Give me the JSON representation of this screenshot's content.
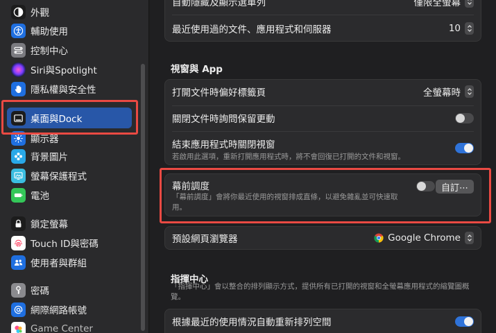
{
  "sidebar": {
    "items": [
      {
        "label": "外觀",
        "icon": "appearance-icon"
      },
      {
        "label": "輔助使用",
        "icon": "accessibility-icon"
      },
      {
        "label": "控制中心",
        "icon": "control-center-icon"
      },
      {
        "label": "Siri與Spotlight",
        "icon": "siri-icon"
      },
      {
        "label": "隱私權與安全性",
        "icon": "hand-icon"
      },
      {
        "label": "桌面與Dock",
        "icon": "dock-icon"
      },
      {
        "label": "顯示器",
        "icon": "display-icon"
      },
      {
        "label": "背景圖片",
        "icon": "wallpaper-icon"
      },
      {
        "label": "螢幕保護程式",
        "icon": "screensaver-icon"
      },
      {
        "label": "電池",
        "icon": "battery-icon"
      },
      {
        "label": "鎖定螢幕",
        "icon": "lock-icon"
      },
      {
        "label": "Touch ID與密碼",
        "icon": "fingerprint-icon"
      },
      {
        "label": "使用者與群組",
        "icon": "users-icon"
      },
      {
        "label": "密碼",
        "icon": "key-icon"
      },
      {
        "label": "網際網路帳號",
        "icon": "at-icon"
      },
      {
        "label": "Game Center",
        "icon": "game-center-icon"
      }
    ]
  },
  "main": {
    "top_card": {
      "row1_label": "自動隱藏及顯示選單列",
      "row1_value": "僅限全螢幕",
      "row2_label": "最近使用過的文件、應用程式和伺服器",
      "row2_value": "10"
    },
    "windows_section": {
      "title": "視窗與 App",
      "tabs_label": "打開文件時偏好標籤頁",
      "tabs_value": "全螢幕時",
      "ask_save_label": "關閉文件時詢問保留更動",
      "close_windows_label": "結束應用程式時關閉視窗",
      "close_windows_desc": "若啟用此選項，重新打開應用程式時，將不會回復已打開的文件和視窗。"
    },
    "stage_manager": {
      "label": "幕前調度",
      "desc": "「幕前調度」會將你最近使用的視窗排成直條，以避免雜亂並可快速取用。",
      "customize_button": "自訂⋯"
    },
    "browser": {
      "label": "預設網頁瀏覽器",
      "value": "Google Chrome"
    },
    "mission_control": {
      "title": "指揮中心",
      "desc": "「指揮中心」會以整合的排列顯示方式，提供所有已打開的視窗和全螢幕應用程式的縮覽圖概覽。",
      "rearrange_label": "根據最近的使用情況自動重新排列空間"
    }
  },
  "colors": {
    "accent": "#2857a8",
    "toggle_on": "#2f73d9",
    "highlight": "#ea4a43"
  }
}
